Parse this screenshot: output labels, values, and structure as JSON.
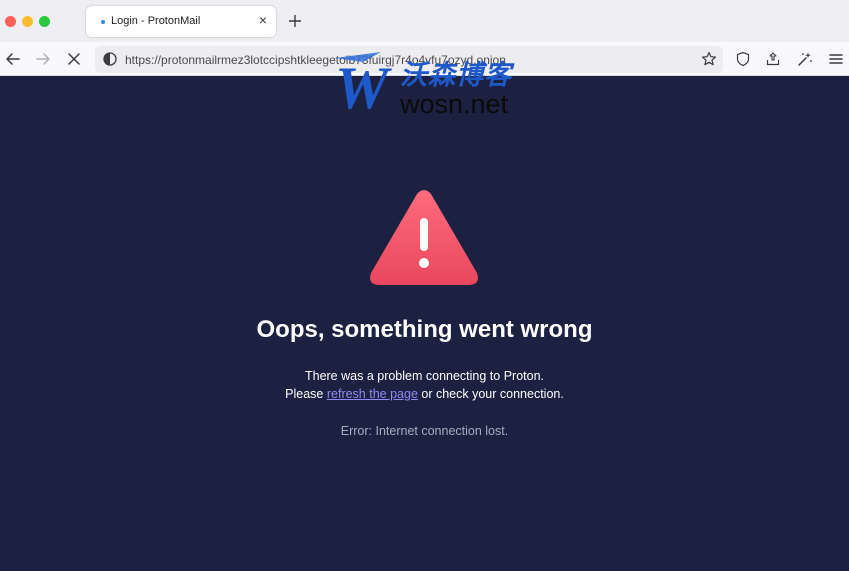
{
  "browser": {
    "tab": {
      "title": "Login - ProtonMail",
      "close_glyph": "×"
    },
    "url": "https://protonmailrmez3lotccipshtkleegetolb73fuirgj7r4o4vfu7ozyd.onion",
    "toolbar_icons": [
      "back-icon",
      "forward-icon",
      "stop-loading-icon",
      "site-identity-icon",
      "bookmark-star-icon",
      "shield-icon",
      "extensions-icon",
      "customize-icon",
      "menu-icon"
    ]
  },
  "watermark": {
    "cn": "沃森博客",
    "en": "wosn.net",
    "logo_letter": "W"
  },
  "error": {
    "title": "Oops, something went wrong",
    "line1": "There was a problem connecting to Proton.",
    "line2_prefix": "Please ",
    "refresh_link": "refresh the page",
    "line2_suffix": " or check your connection.",
    "detail": "Error: Internet connection lost."
  },
  "colors": {
    "background": "#1c2141",
    "warning_gradient": [
      "#ff6b7e",
      "#e8475c"
    ],
    "link": "#8f8cf5"
  }
}
